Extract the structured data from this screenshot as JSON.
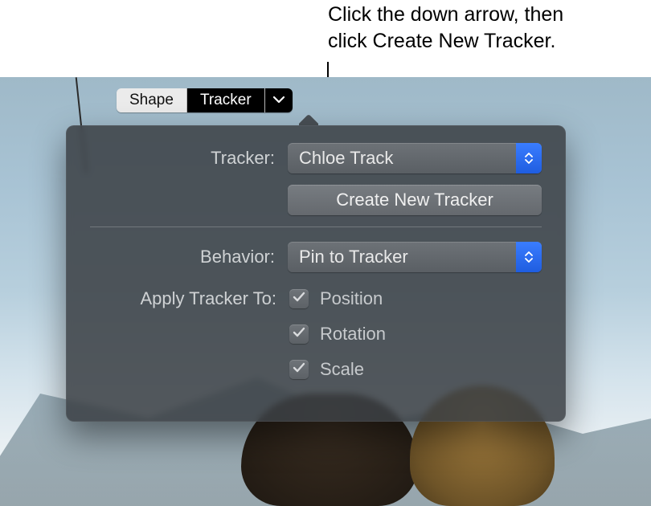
{
  "annotation": {
    "line1": "Click the down arrow, then",
    "line2": "click Create New Tracker."
  },
  "segmented": {
    "shape": "Shape",
    "tracker": "Tracker"
  },
  "popover": {
    "tracker_label": "Tracker:",
    "tracker_value": "Chloe Track",
    "create_btn": "Create New Tracker",
    "behavior_label": "Behavior:",
    "behavior_value": "Pin to Tracker",
    "apply_label": "Apply Tracker To:",
    "opts": {
      "position": "Position",
      "rotation": "Rotation",
      "scale": "Scale"
    }
  },
  "icons": {
    "chevron_down": "chevron-down-icon",
    "stepper": "stepper-icon",
    "check": "checkmark-icon"
  }
}
